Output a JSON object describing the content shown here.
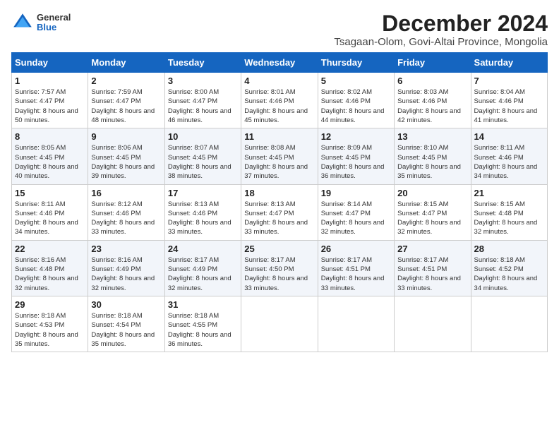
{
  "logo": {
    "general": "General",
    "blue": "Blue"
  },
  "title": "December 2024",
  "subtitle": "Tsagaan-Olom, Govi-Altai Province, Mongolia",
  "weekdays": [
    "Sunday",
    "Monday",
    "Tuesday",
    "Wednesday",
    "Thursday",
    "Friday",
    "Saturday"
  ],
  "weeks": [
    [
      {
        "day": "1",
        "info": "Sunrise: 7:57 AM\nSunset: 4:47 PM\nDaylight: 8 hours and 50 minutes."
      },
      {
        "day": "2",
        "info": "Sunrise: 7:59 AM\nSunset: 4:47 PM\nDaylight: 8 hours and 48 minutes."
      },
      {
        "day": "3",
        "info": "Sunrise: 8:00 AM\nSunset: 4:47 PM\nDaylight: 8 hours and 46 minutes."
      },
      {
        "day": "4",
        "info": "Sunrise: 8:01 AM\nSunset: 4:46 PM\nDaylight: 8 hours and 45 minutes."
      },
      {
        "day": "5",
        "info": "Sunrise: 8:02 AM\nSunset: 4:46 PM\nDaylight: 8 hours and 44 minutes."
      },
      {
        "day": "6",
        "info": "Sunrise: 8:03 AM\nSunset: 4:46 PM\nDaylight: 8 hours and 42 minutes."
      },
      {
        "day": "7",
        "info": "Sunrise: 8:04 AM\nSunset: 4:46 PM\nDaylight: 8 hours and 41 minutes."
      }
    ],
    [
      {
        "day": "8",
        "info": "Sunrise: 8:05 AM\nSunset: 4:45 PM\nDaylight: 8 hours and 40 minutes."
      },
      {
        "day": "9",
        "info": "Sunrise: 8:06 AM\nSunset: 4:45 PM\nDaylight: 8 hours and 39 minutes."
      },
      {
        "day": "10",
        "info": "Sunrise: 8:07 AM\nSunset: 4:45 PM\nDaylight: 8 hours and 38 minutes."
      },
      {
        "day": "11",
        "info": "Sunrise: 8:08 AM\nSunset: 4:45 PM\nDaylight: 8 hours and 37 minutes."
      },
      {
        "day": "12",
        "info": "Sunrise: 8:09 AM\nSunset: 4:45 PM\nDaylight: 8 hours and 36 minutes."
      },
      {
        "day": "13",
        "info": "Sunrise: 8:10 AM\nSunset: 4:45 PM\nDaylight: 8 hours and 35 minutes."
      },
      {
        "day": "14",
        "info": "Sunrise: 8:11 AM\nSunset: 4:46 PM\nDaylight: 8 hours and 34 minutes."
      }
    ],
    [
      {
        "day": "15",
        "info": "Sunrise: 8:11 AM\nSunset: 4:46 PM\nDaylight: 8 hours and 34 minutes."
      },
      {
        "day": "16",
        "info": "Sunrise: 8:12 AM\nSunset: 4:46 PM\nDaylight: 8 hours and 33 minutes."
      },
      {
        "day": "17",
        "info": "Sunrise: 8:13 AM\nSunset: 4:46 PM\nDaylight: 8 hours and 33 minutes."
      },
      {
        "day": "18",
        "info": "Sunrise: 8:13 AM\nSunset: 4:47 PM\nDaylight: 8 hours and 33 minutes."
      },
      {
        "day": "19",
        "info": "Sunrise: 8:14 AM\nSunset: 4:47 PM\nDaylight: 8 hours and 32 minutes."
      },
      {
        "day": "20",
        "info": "Sunrise: 8:15 AM\nSunset: 4:47 PM\nDaylight: 8 hours and 32 minutes."
      },
      {
        "day": "21",
        "info": "Sunrise: 8:15 AM\nSunset: 4:48 PM\nDaylight: 8 hours and 32 minutes."
      }
    ],
    [
      {
        "day": "22",
        "info": "Sunrise: 8:16 AM\nSunset: 4:48 PM\nDaylight: 8 hours and 32 minutes."
      },
      {
        "day": "23",
        "info": "Sunrise: 8:16 AM\nSunset: 4:49 PM\nDaylight: 8 hours and 32 minutes."
      },
      {
        "day": "24",
        "info": "Sunrise: 8:17 AM\nSunset: 4:49 PM\nDaylight: 8 hours and 32 minutes."
      },
      {
        "day": "25",
        "info": "Sunrise: 8:17 AM\nSunset: 4:50 PM\nDaylight: 8 hours and 33 minutes."
      },
      {
        "day": "26",
        "info": "Sunrise: 8:17 AM\nSunset: 4:51 PM\nDaylight: 8 hours and 33 minutes."
      },
      {
        "day": "27",
        "info": "Sunrise: 8:17 AM\nSunset: 4:51 PM\nDaylight: 8 hours and 33 minutes."
      },
      {
        "day": "28",
        "info": "Sunrise: 8:18 AM\nSunset: 4:52 PM\nDaylight: 8 hours and 34 minutes."
      }
    ],
    [
      {
        "day": "29",
        "info": "Sunrise: 8:18 AM\nSunset: 4:53 PM\nDaylight: 8 hours and 35 minutes."
      },
      {
        "day": "30",
        "info": "Sunrise: 8:18 AM\nSunset: 4:54 PM\nDaylight: 8 hours and 35 minutes."
      },
      {
        "day": "31",
        "info": "Sunrise: 8:18 AM\nSunset: 4:55 PM\nDaylight: 8 hours and 36 minutes."
      },
      null,
      null,
      null,
      null
    ]
  ]
}
